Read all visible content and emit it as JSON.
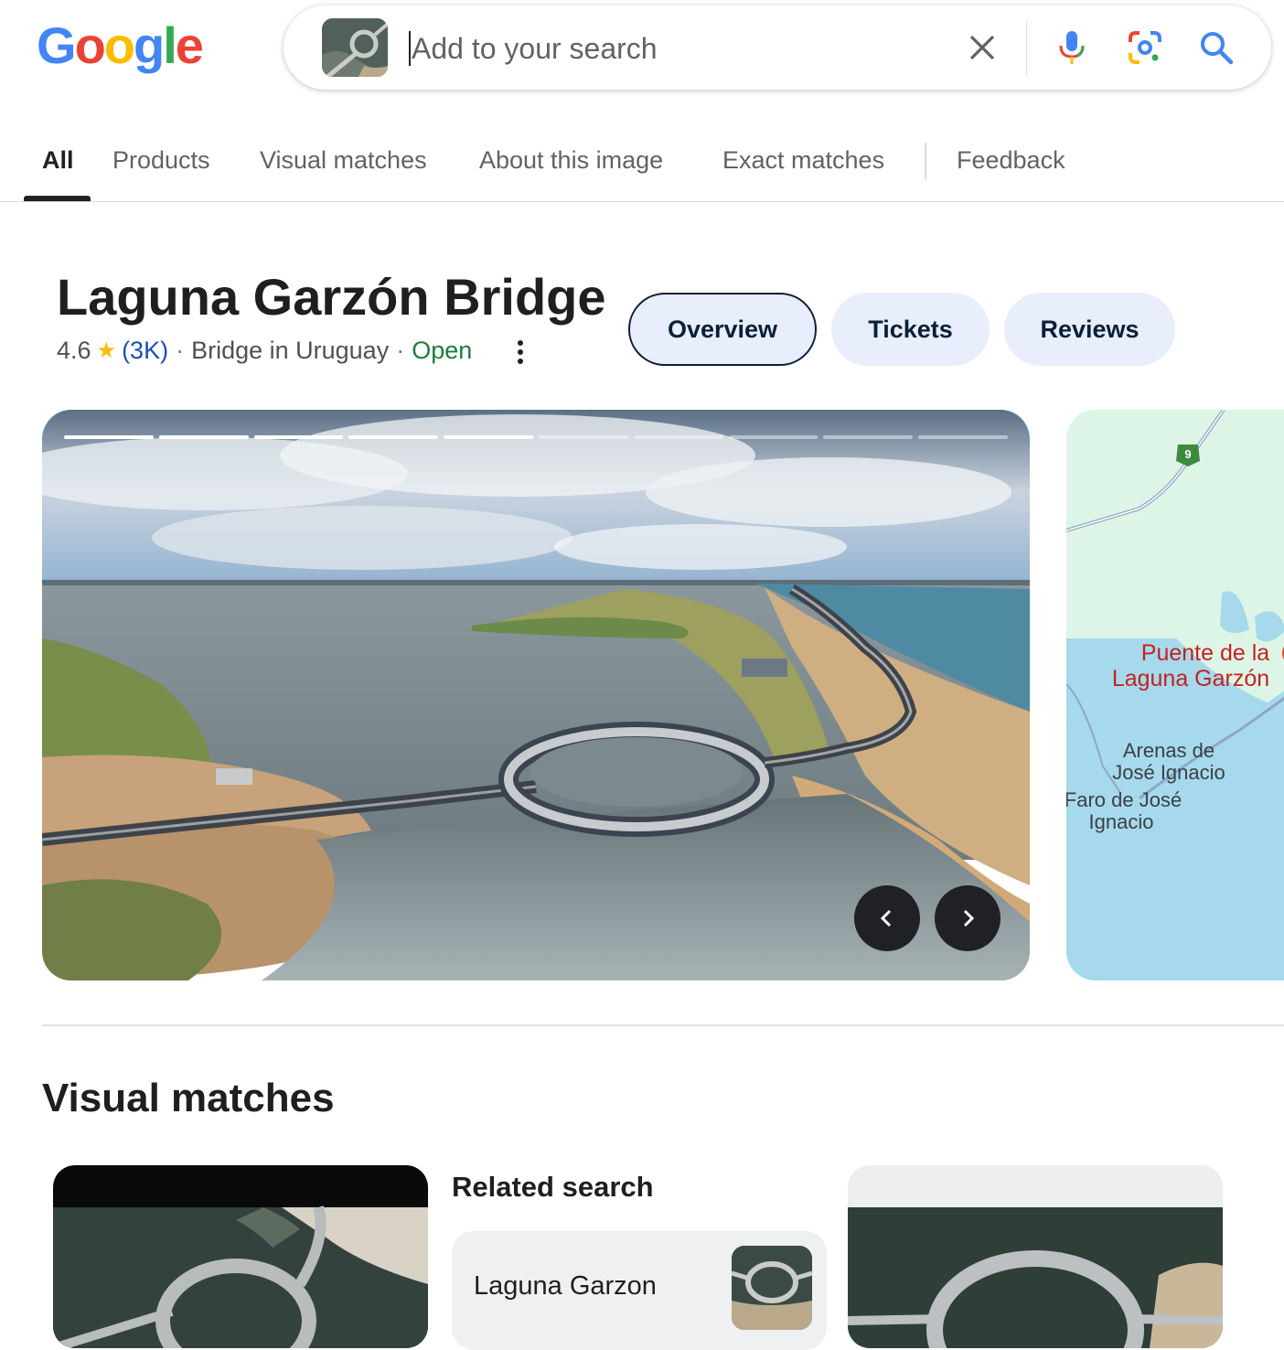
{
  "logo": {
    "letters": [
      "G",
      "o",
      "o",
      "g",
      "l",
      "e"
    ],
    "colors": [
      "#4285f4",
      "#ea4335",
      "#fbbc05",
      "#4285f4",
      "#34a853",
      "#ea4335"
    ]
  },
  "search": {
    "placeholder": "Add to your search",
    "value": "",
    "icons": [
      "image-thumbnail",
      "close-icon",
      "mic-icon",
      "lens-icon",
      "search-icon"
    ]
  },
  "tabs": [
    {
      "label": "All",
      "active": true
    },
    {
      "label": "Products"
    },
    {
      "label": "Visual matches"
    },
    {
      "label": "About this image"
    },
    {
      "label": "Exact matches"
    },
    {
      "label": "Feedback"
    }
  ],
  "entity": {
    "title": "Laguna Garzón Bridge",
    "rating": "4.6",
    "review_count": "(3K)",
    "category": "Bridge in Uruguay",
    "status": "Open",
    "chips": [
      {
        "label": "Overview",
        "active": true
      },
      {
        "label": "Tickets"
      },
      {
        "label": "Reviews"
      }
    ]
  },
  "carousel": {
    "total_slides": 10,
    "current_slide": 5,
    "prev_icon": "chevron-left-icon",
    "next_icon": "chevron-right-icon"
  },
  "map": {
    "route_shield": "9",
    "labels": {
      "place_line1": "Puente de la",
      "place_line2": "Laguna Garzón",
      "arenas_line1": "Arenas de",
      "arenas_line2": "José Ignacio",
      "faro_line1": "Faro de José",
      "faro_line2": "Ignacio"
    },
    "colors": {
      "land": "#ddf5e6",
      "water": "#a6d9ec",
      "place": "#c5221f"
    }
  },
  "visual_matches": {
    "title": "Visual matches",
    "related_title": "Related search",
    "related_label": "Laguna Garzon"
  },
  "colors": {
    "accent": "#1a4fb5",
    "chip_bg": "#e8eefc",
    "open": "#188038",
    "star": "#fbbc04"
  }
}
